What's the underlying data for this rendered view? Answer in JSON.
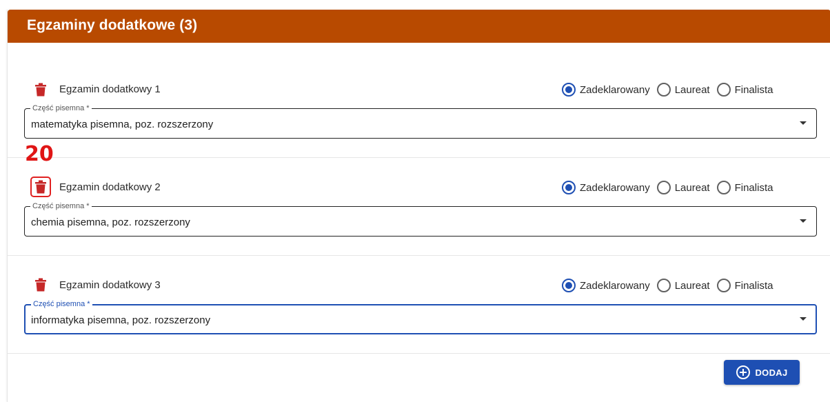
{
  "card": {
    "title": "Egzaminy dodatkowe (3)"
  },
  "exams": [
    {
      "label": "Egzamin dodatkowy 1",
      "field_legend": "Część pisemna *",
      "field_value": "matematyka pisemna, poz. rozszerzony",
      "selected_status": "Zadeklarowany"
    },
    {
      "label": "Egzamin dodatkowy 2",
      "field_legend": "Część pisemna *",
      "field_value": "chemia pisemna, poz. rozszerzony",
      "selected_status": "Zadeklarowany"
    },
    {
      "label": "Egzamin dodatkowy 3",
      "field_legend": "Część pisemna *",
      "field_value": "informatyka pisemna, poz. rozszerzony",
      "selected_status": "Zadeklarowany"
    }
  ],
  "status_options": [
    "Zadeklarowany",
    "Laureat",
    "Finalista"
  ],
  "annotation": {
    "badge": "20"
  },
  "actions": {
    "add_label": "DODAJ"
  },
  "colors": {
    "header": "#b84a00",
    "accent": "#1e4fb3",
    "trash": "#c62828",
    "badge": "#e01515"
  },
  "icons": {
    "delete": "trash-icon",
    "add": "plus-circle-icon",
    "dropdown": "dropdown-arrow-icon"
  }
}
